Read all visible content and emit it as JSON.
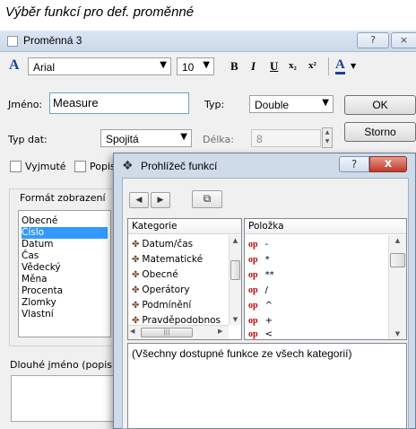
{
  "caption": "Výběr funkcí pro def. proměnné",
  "variable_dialog": {
    "title": "Proměnná 3",
    "help_glyph": "?",
    "close_glyph": "×",
    "toolbar": {
      "font_name": "Arial",
      "font_size": "10",
      "bold": "B",
      "italic": "I",
      "underline": "U",
      "subscript": "x₂",
      "superscript": "x²",
      "font_color": "A"
    },
    "name_label": "Jméno:",
    "name_value": "Measure",
    "type_label": "Typ:",
    "type_value": "Double",
    "data_type_label": "Typ dat:",
    "data_type_value": "Spojitá",
    "length_label": "Délka:",
    "length_value": "8",
    "ok_label": "OK",
    "cancel_label": "Storno",
    "excluded_label": "Vyjmuté",
    "popis_label": "Popis",
    "format_group_label": "Formát zobrazení",
    "format_items": [
      "Obecné",
      "Číslo",
      "Datum",
      "Čas",
      "Vědecký",
      "Měna",
      "Procenta",
      "Zlomky",
      "Vlastní"
    ],
    "format_selected_index": 1,
    "long_name_label": "Dlouhé jméno (popis či"
  },
  "function_browser": {
    "title": "Prohlížeč funkcí",
    "help_glyph": "?",
    "close_glyph": "x",
    "category_header": "Kategorie",
    "item_header": "Položka",
    "categories": [
      "Datum/čas",
      "Matematické",
      "Obecné",
      "Operátory",
      "Podmínění",
      "Pravděpodobnos"
    ],
    "items": [
      {
        "tag": "op",
        "symbol": "-"
      },
      {
        "tag": "op",
        "symbol": "*"
      },
      {
        "tag": "op",
        "symbol": "**"
      },
      {
        "tag": "op",
        "symbol": "/"
      },
      {
        "tag": "op",
        "symbol": "^"
      },
      {
        "tag": "op",
        "symbol": "+"
      },
      {
        "tag": "op",
        "symbol": "<"
      }
    ],
    "description": "(Všechny dostupné funkce ze všech kategorií)"
  }
}
